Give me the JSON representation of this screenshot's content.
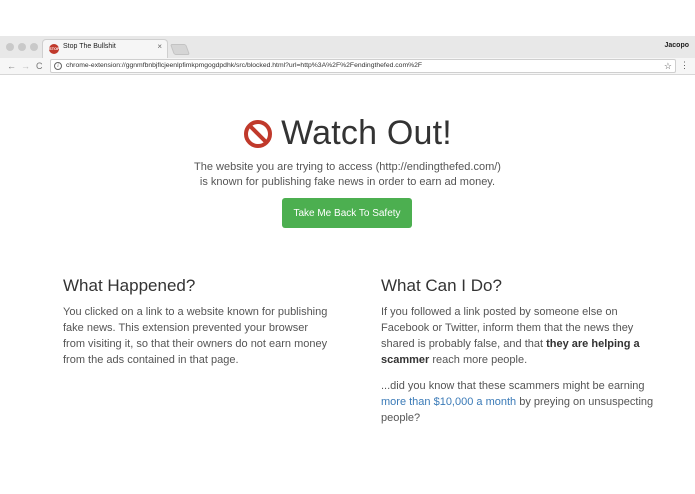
{
  "browser": {
    "tab": {
      "favicon_text": "STOP",
      "title": "Stop The Bullshit",
      "close_glyph": "×"
    },
    "profile_name": "Jacopo",
    "url": "chrome-extension://ggnmfbnbjflcjeenlpfimkpmgogdpdhk/src/blocked.html?url=http%3A%2F%2Fendingthefed.com%2F",
    "nav": {
      "back": "←",
      "forward": "→",
      "reload": "C"
    },
    "icons": {
      "info": "i",
      "star": "☆",
      "menu": "⋮"
    }
  },
  "page": {
    "headline": "Watch Out!",
    "lede_line1": "The website you are trying to access (http://endingthefed.com/)",
    "lede_line2": "is known for publishing fake news in order to earn ad money.",
    "safety_button": "Take Me Back To Safety",
    "what_happened": {
      "heading": "What Happened?",
      "body": "You clicked on a link to a website known for publishing fake news. This extension prevented your browser from visiting it, so that their owners do not earn money from the ads contained in that page."
    },
    "what_can_i_do": {
      "heading": "What Can I Do?",
      "p1_before": "If you followed a link posted by someone else on Facebook or Twitter, inform them that the news they shared is probably false, and that ",
      "p1_strong": "they are helping a scammer",
      "p1_after": " reach more people.",
      "p2_before": "...did you know that these scammers might be earning ",
      "p2_link": "more than $10,000 a month",
      "p2_after": " by preying on unsuspecting people?"
    }
  },
  "colors": {
    "accent_button": "#4caf50",
    "stop_icon": "#c0392b",
    "link": "#3a7ab7"
  }
}
